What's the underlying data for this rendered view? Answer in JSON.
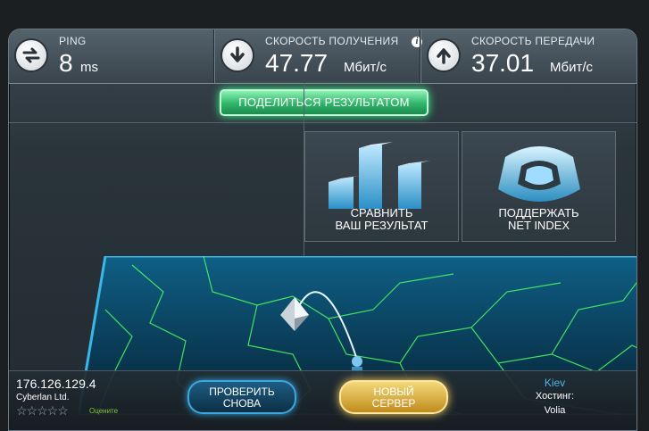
{
  "stats": {
    "ping": {
      "label": "PING",
      "value": "8",
      "unit": "ms"
    },
    "download": {
      "label": "СКОРОСТЬ ПОЛУЧЕНИЯ",
      "value": "47.77",
      "unit": "Мбит/с"
    },
    "upload": {
      "label": "СКОРОСТЬ ПЕРЕДАЧИ",
      "value": "37.01",
      "unit": "Мбит/с"
    }
  },
  "share_button": "ПОДЕЛИТЬСЯ РЕЗУЛЬТАТОМ",
  "panels": {
    "compare": {
      "line1": "СРАВНИТЬ",
      "line2": "ВАШ РЕЗУЛЬТАТ"
    },
    "support": {
      "line1": "ПОДДЕРЖАТЬ",
      "line2": "NET INDEX"
    }
  },
  "bottom": {
    "ip": "176.126.129.4",
    "isp": "Cyberlan Ltd.",
    "rate_label": "Оцените",
    "retest": {
      "line1": "ПРОВЕРИТЬ",
      "line2": "СНОВА"
    },
    "new_server": {
      "line1": "НОВЫЙ",
      "line2": "СЕРВЕР"
    },
    "server": {
      "city": "Kiev",
      "hosting_label": "Хостинг:",
      "host": "Volia"
    }
  },
  "colors": {
    "accent_green": "#3dff91",
    "map_lines": "#3dff6a",
    "map_glow": "#2aa7d6"
  },
  "icons": {
    "ping": "ping-arrows-icon",
    "download": "download-arrow-icon",
    "upload": "upload-arrow-icon",
    "info": "info-icon"
  }
}
